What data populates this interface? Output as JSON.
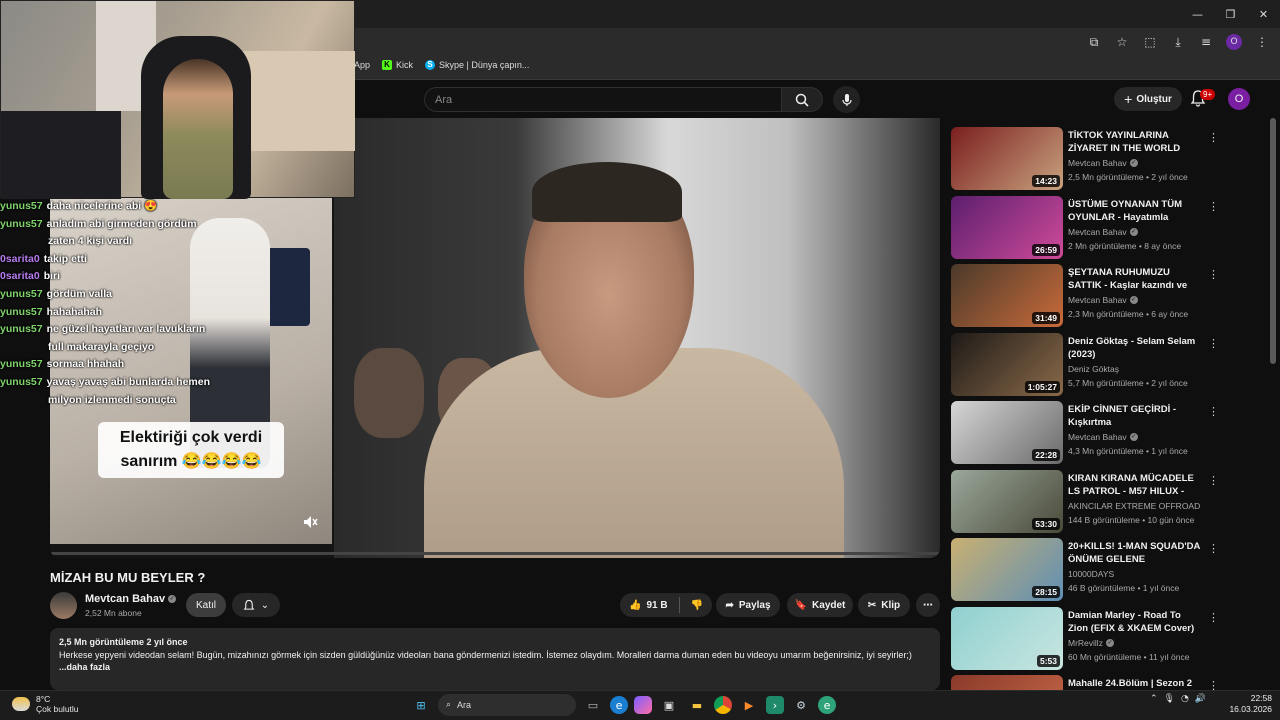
{
  "browser": {
    "window_controls": [
      "—",
      "❐",
      "✕"
    ],
    "bookmarks": [
      {
        "label": "App",
        "icon": "app-icon",
        "color": "#666666"
      },
      {
        "label": "Kick",
        "icon": "kick-icon",
        "color": "#53fc18"
      },
      {
        "label": "Skype | Dünya çapın...",
        "icon": "skype-icon",
        "color": "#00aff0"
      }
    ],
    "profile_initial": "O"
  },
  "youtube": {
    "search_placeholder": "Ara",
    "create_label": "Oluştur",
    "notifications_badge": "9+",
    "avatar_initial": "O"
  },
  "webcam_chat": [
    {
      "user": "yunus57",
      "user_color": "#7fd36b",
      "message": "daha nicelerine abi 😍",
      "continuation": ""
    },
    {
      "user": "yunus57",
      "user_color": "#7fd36b",
      "message": "anladım abi girmeden gördüm",
      "continuation": "zaten 4 kişi vardı"
    },
    {
      "user": "0sarita0",
      "user_color": "#b77cf0",
      "message": "takip etti",
      "continuation": ""
    },
    {
      "user": "0sarita0",
      "user_color": "#b77cf0",
      "message": "biri",
      "continuation": ""
    },
    {
      "user": "yunus57",
      "user_color": "#7fd36b",
      "message": "gördüm valla",
      "continuation": ""
    },
    {
      "user": "yunus57",
      "user_color": "#7fd36b",
      "message": "hahahahah",
      "continuation": ""
    },
    {
      "user": "yunus57",
      "user_color": "#7fd36b",
      "message": "ne güzel hayatları var lavukların",
      "continuation": "full makarayla geçiyo"
    },
    {
      "user": "yunus57",
      "user_color": "#7fd36b",
      "message": "sormaa hhahah",
      "continuation": ""
    },
    {
      "user": "yunus57",
      "user_color": "#7fd36b",
      "message": "yavaş yavaş abi bunlarda hemen",
      "continuation": "milyon izlenmedi sonuçta"
    }
  ],
  "video": {
    "caption_line1": "Elektiriği çok verdi",
    "caption_line2": "sanırım 😂😂😂😂",
    "title": "MİZAH BU MU BEYLER ?",
    "channel": "Mevtcan Bahav",
    "subscribers": "2,52 Mn abone",
    "join_label": "Katıl",
    "likes": "91 B",
    "share_label": "Paylaş",
    "save_label": "Kaydet",
    "clip_label": "Klip",
    "description_stats": "2,5 Mn görüntüleme  2 yıl önce",
    "description_text": "Herkese yepyeni videodan selam! Bugün, mizahınızı görmek için sizden güldüğünüz videoları bana göndermenizi istedim. İstemez olaydım. Moralleri darma duman eden bu videoyu umarım beğenirsiniz, iyi seyirler;)",
    "description_more": "...daha fazla"
  },
  "recommendations": [
    {
      "title": "TİKTOK YAYINLARINA ZİYARET IN THE WORLD",
      "channel": "Mevtcan Bahav",
      "verified": true,
      "meta": "2,5 Mn görüntüleme • 2 yıl önce",
      "duration": "14:23",
      "thumb_colors": [
        "#7a1f1f",
        "#c9a27e"
      ]
    },
    {
      "title": "ÜSTÜME OYNANAN TÜM OYUNLAR - Hayatımla oynandı..",
      "channel": "Mevtcan Bahav",
      "verified": true,
      "meta": "2 Mn görüntüleme • 8 ay önce",
      "duration": "26:59",
      "thumb_colors": [
        "#5b1f6e",
        "#d04a9a"
      ]
    },
    {
      "title": "ŞEYTANA RUHUMUZU SATTIK - Kaşlar kazındı ve araba çarptı ...",
      "channel": "Mevtcan Bahav",
      "verified": true,
      "meta": "2,3 Mn görüntüleme • 6 ay önce",
      "duration": "31:49",
      "thumb_colors": [
        "#4a3a2a",
        "#c96a3a"
      ]
    },
    {
      "title": "Deniz Göktaş - Selam Selam (2023)",
      "channel": "Deniz Göktaş",
      "verified": false,
      "meta": "5,7 Mn görüntüleme • 2 yıl önce",
      "duration": "1:05:27",
      "thumb_colors": [
        "#1e1a17",
        "#8a6a4a"
      ]
    },
    {
      "title": "EKİP CİNNET GEÇİRDİ - Kışkırtma",
      "channel": "Mevtcan Bahav",
      "verified": true,
      "meta": "4,3 Mn görüntüleme • 1 yıl önce",
      "duration": "22:28",
      "thumb_colors": [
        "#d6d6d6",
        "#6a6a6a"
      ]
    },
    {
      "title": "KIRAN KIRANA MÜCADELE LS PATROL - M57 HILUX - L200 - ...",
      "channel": "AKINCILAR EXTREME OFFROAD",
      "verified": false,
      "meta": "144 B görüntüleme • 10 gün önce",
      "duration": "53:30",
      "thumb_colors": [
        "#9aa89a",
        "#4a4a3a"
      ]
    },
    {
      "title": "20+KILLS! 1-MAN SQUAD'DA ÖNÜME GELENE HEADSHOT! -...",
      "channel": "10000DAYS",
      "verified": false,
      "meta": "46 B görüntüleme • 1 yıl önce",
      "duration": "28:15",
      "thumb_colors": [
        "#c9b071",
        "#5f8fb5"
      ]
    },
    {
      "title": "Damian Marley - Road To Zion (EFIX & XKAEM Cover)",
      "channel": "MrRevillz",
      "verified": true,
      "meta": "60 Mn görüntüleme • 11 yıl önce",
      "duration": "5:53",
      "thumb_colors": [
        "#8fd0cf",
        "#c9e6e1"
      ]
    },
    {
      "title": "Mahalle 24.Bölüm | Sezon 2",
      "channel": "",
      "verified": false,
      "meta": "",
      "duration": "",
      "thumb_colors": [
        "#8a3a2a",
        "#c96a4a"
      ]
    }
  ],
  "taskbar": {
    "temperature": "8°C",
    "weather": "Çok bulutlu",
    "search_label": "Ara",
    "time": "22:58",
    "date": "16.03.2026",
    "apps": [
      "windows-logo-icon",
      "task-view-icon",
      "edge-icon",
      "copilot-icon",
      "store-icon",
      "file-explorer-icon",
      "chrome-icon",
      "media-player-icon",
      "terminal-icon",
      "steam-icon",
      "edge-beta-icon"
    ]
  }
}
